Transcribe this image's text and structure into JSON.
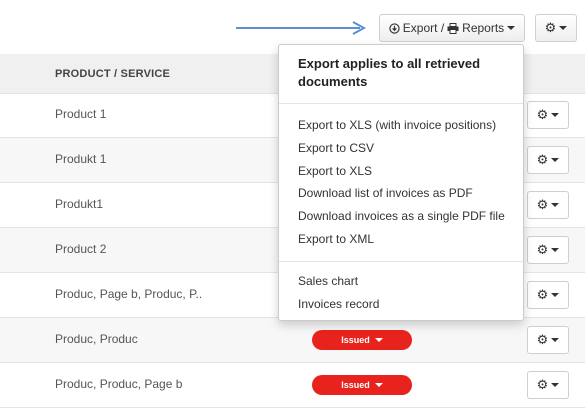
{
  "toolbar": {
    "export_label": "Export /",
    "reports_label": "Reports"
  },
  "table": {
    "header": "PRODUCT / SERVICE",
    "rows": [
      {
        "name": "Product 1",
        "status": ""
      },
      {
        "name": "Produkt 1",
        "status": ""
      },
      {
        "name": "Produkt1",
        "status": ""
      },
      {
        "name": "Product 2",
        "status": ""
      },
      {
        "name": "Produc, Page b, Produc, P..",
        "status": ""
      },
      {
        "name": "Produc, Produc",
        "status": "Issued"
      },
      {
        "name": "Produc, Produc, Page b",
        "status": "Issued"
      }
    ]
  },
  "dropdown": {
    "heading": "Export applies to all retrieved documents",
    "export_items": [
      "Export to XLS (with invoice positions)",
      "Export to CSV",
      "Export to XLS",
      "Download list of invoices as PDF",
      "Download invoices as a single PDF file",
      "Export to XML"
    ],
    "report_items": [
      "Sales chart",
      "Invoices record"
    ]
  },
  "colors": {
    "status_issued": "#e8231d",
    "arrow": "#5b8fd6"
  },
  "icons": {
    "export": "download-circle-icon",
    "reports": "printer-icon",
    "settings": "gear-icon",
    "caret": "caret-down-icon"
  }
}
